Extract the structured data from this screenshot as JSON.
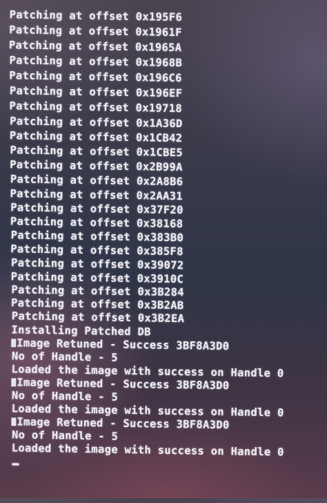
{
  "console": {
    "patch_lines": [
      "Patching at offset 0x195F6",
      "Patching at offset 0x1961F",
      "Patching at offset 0x1965A",
      "Patching at offset 0x1968B",
      "Patching at offset 0x196C6",
      "Patching at offset 0x196EF",
      "Patching at offset 0x19718",
      "Patching at offset 0x1A36D",
      "Patching at offset 0x1CB42",
      "Patching at offset 0x1CBE5",
      "Patching at offset 0x2B99A",
      "Patching at offset 0x2A8B6",
      "Patching at offset 0x2AA31",
      "Patching at offset 0x37F20",
      "Patching at offset 0x38168",
      "Patching at offset 0x383B0",
      "Patching at offset 0x385F8",
      "Patching at offset 0x39072",
      "Patching at offset 0x3910C",
      "Patching at offset 0x3B284",
      "Patching at offset 0x3B2AB",
      "Patching at offset 0x3B2EA"
    ],
    "installing": "Installing Patched DB",
    "image_returned": "Image Retuned - Success 3BF8A3D0",
    "handle_count": "No of Handle - 5",
    "loaded": "Loaded the image with success on Handle 0"
  }
}
